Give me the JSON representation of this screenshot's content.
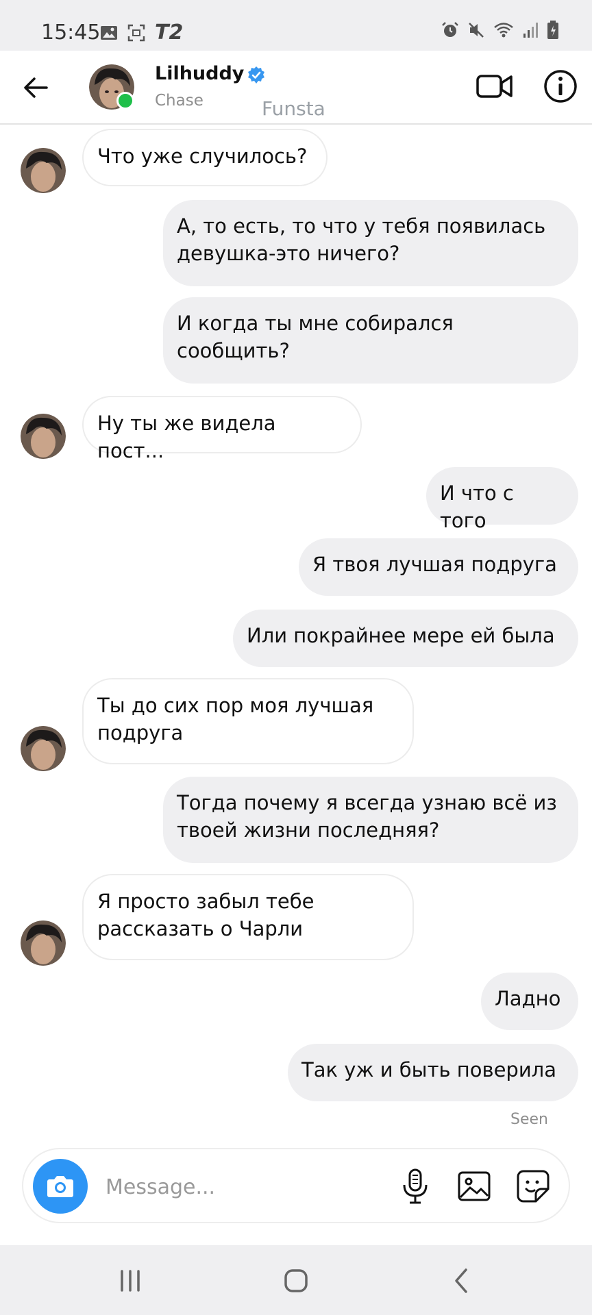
{
  "status_bar": {
    "time": "15:45",
    "carrier": "T2",
    "left_icons": [
      "gallery-icon",
      "screenshot-icon"
    ],
    "right_icons": [
      "alarm-icon",
      "mute-icon",
      "wifi-icon",
      "signal-icon",
      "battery-icon"
    ]
  },
  "header": {
    "name": "Lilhuddy",
    "subtitle": "Chase",
    "extra_label": "Funsta",
    "verified": true,
    "online": true,
    "icons": [
      "back-arrow-icon",
      "video-call-icon",
      "info-icon"
    ]
  },
  "messages": [
    {
      "sender": "them",
      "text": "Что уже случилось?"
    },
    {
      "sender": "me",
      "text": "А, то есть, то что у тебя появилась девушка-это ничего?"
    },
    {
      "sender": "me",
      "text": "И когда ты мне собирался сообщить?"
    },
    {
      "sender": "them",
      "text": "Ну ты же видела пост..."
    },
    {
      "sender": "me",
      "text": "И что с того"
    },
    {
      "sender": "me",
      "text": "Я твоя лучшая подруга"
    },
    {
      "sender": "me",
      "text": "Или покрайнее мере ей была"
    },
    {
      "sender": "them",
      "text": "Ты до сих пор моя лучшая подруга"
    },
    {
      "sender": "me",
      "text": "Тогда почему я всегда узнаю всё из твоей жизни последняя?"
    },
    {
      "sender": "them",
      "text": "Я просто забыл тебе рассказать о Чарли"
    },
    {
      "sender": "me",
      "text": "Ладно"
    },
    {
      "sender": "me",
      "text": "Так уж и быть поверила"
    }
  ],
  "seen_label": "Seen",
  "composer": {
    "placeholder": "Message...",
    "value": "",
    "icons": [
      "camera-icon",
      "microphone-icon",
      "gallery-icon",
      "sticker-icon"
    ]
  },
  "nav_bar": {
    "icons": [
      "recent-apps-icon",
      "home-icon",
      "back-icon"
    ]
  },
  "colors": {
    "accent": "#2d95f5",
    "online": "#1fbf4a",
    "outgoing_bubble": "#efeff1",
    "incoming_bubble": "#ffffff"
  }
}
